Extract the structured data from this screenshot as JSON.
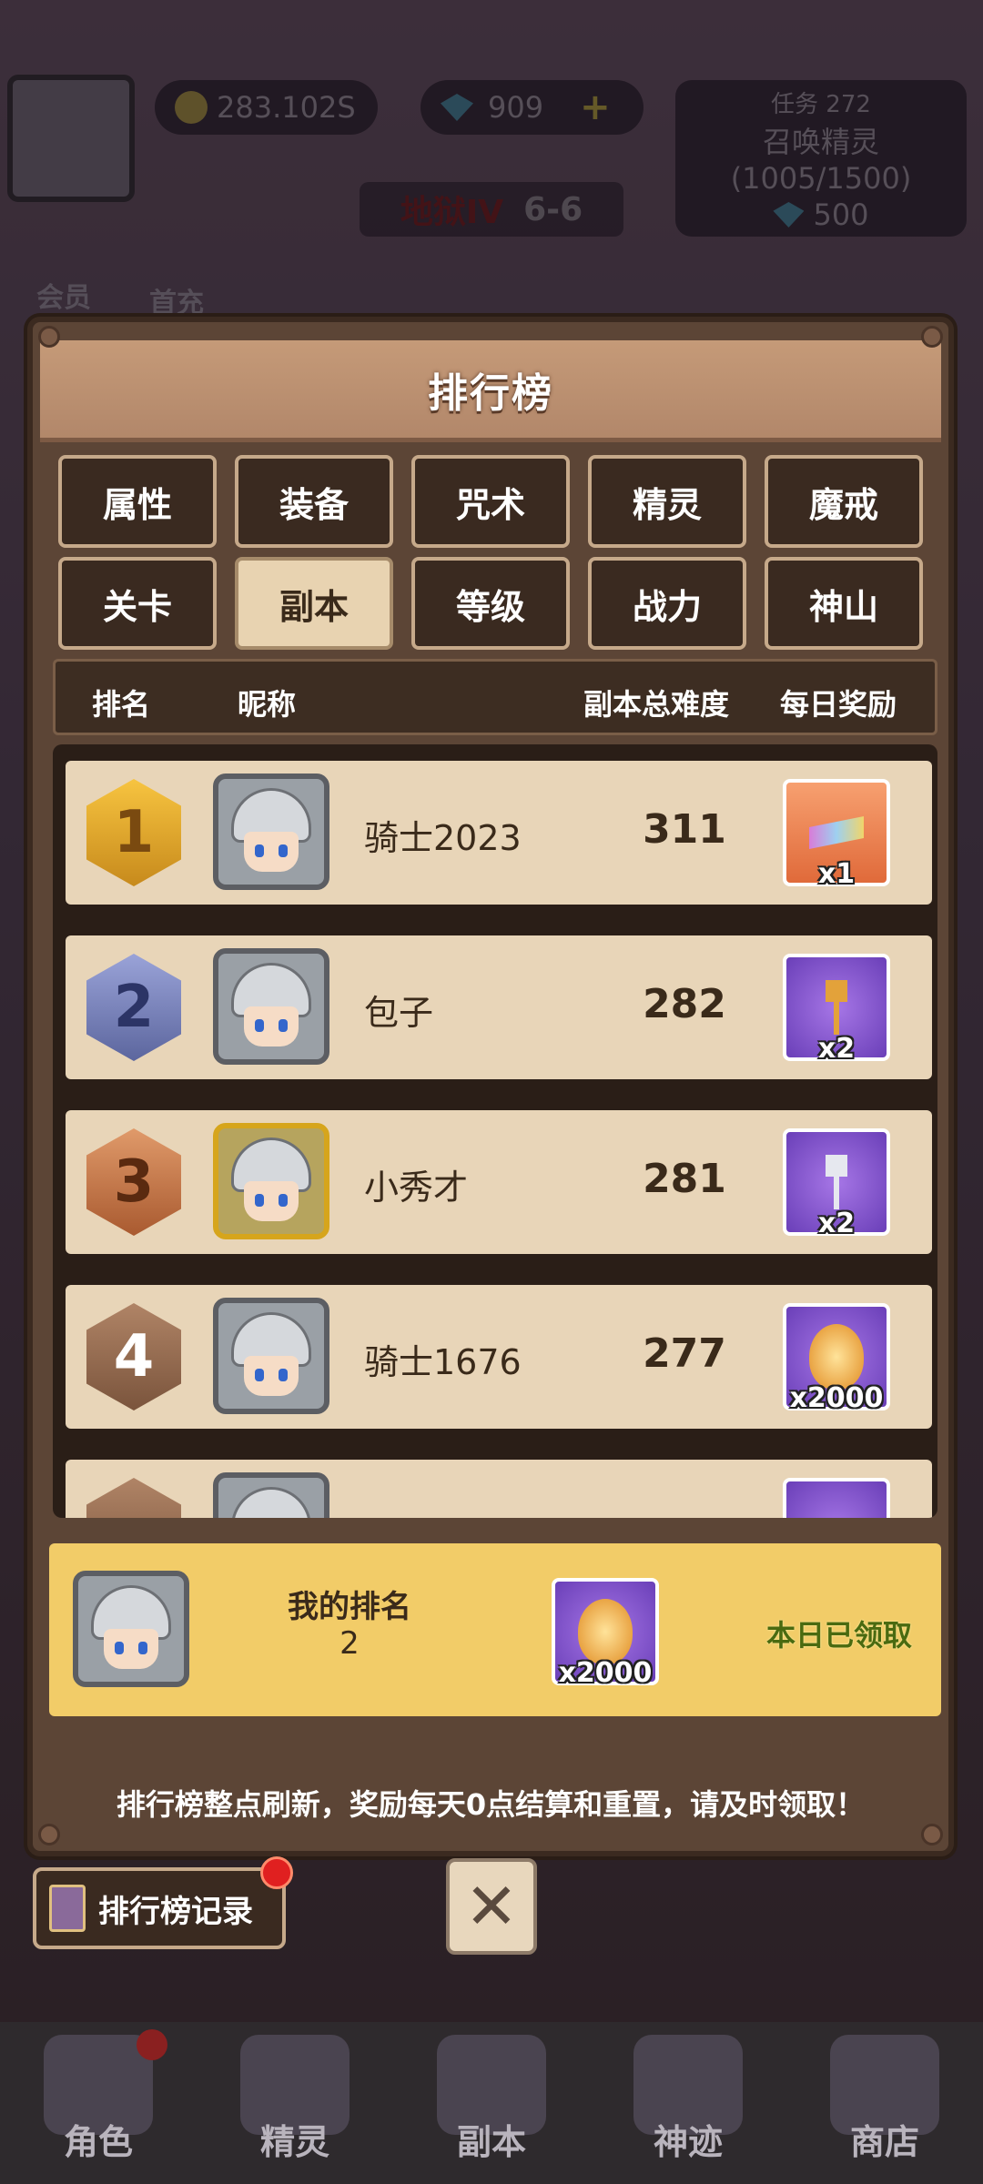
{
  "hud": {
    "gold": "283.102S",
    "gems": "909",
    "plus": "+",
    "task_title": "任务 272",
    "task_desc": "召唤精灵(1005/1500)",
    "task_reward": "500",
    "stage_name": "地狱IV",
    "stage_level": "6-6",
    "member_label": "会员",
    "first_charge_label": "首充"
  },
  "panel": {
    "title": "排行榜",
    "tabs": [
      {
        "label": "属性",
        "active": false
      },
      {
        "label": "装备",
        "active": false
      },
      {
        "label": "咒术",
        "active": false
      },
      {
        "label": "精灵",
        "active": false
      },
      {
        "label": "魔戒",
        "active": false
      },
      {
        "label": "关卡",
        "active": false
      },
      {
        "label": "副本",
        "active": true
      },
      {
        "label": "等级",
        "active": false
      },
      {
        "label": "战力",
        "active": false
      },
      {
        "label": "神山",
        "active": false
      }
    ],
    "columns": {
      "rank": "排名",
      "nickname": "昵称",
      "difficulty": "副本总难度",
      "reward": "每日奖励"
    },
    "rows": [
      {
        "rank": "1",
        "nickname": "骑士2023",
        "score": "311",
        "reward_item": "multi-key-icon",
        "reward_qty": "x1"
      },
      {
        "rank": "2",
        "nickname": "包子",
        "score": "282",
        "reward_item": "gold-key-icon",
        "reward_qty": "x2"
      },
      {
        "rank": "3",
        "nickname": "小秀才",
        "score": "281",
        "reward_item": "silver-key-icon",
        "reward_qty": "x2"
      },
      {
        "rank": "4",
        "nickname": "骑士1676",
        "score": "277",
        "reward_item": "egg-icon",
        "reward_qty": "x2000"
      }
    ],
    "my_rank": {
      "label": "我的排名",
      "value": "2",
      "reward_qty": "x2000",
      "status": "本日已领取"
    },
    "notice": "排行榜整点刷新，奖励每天0点结算和重置，请及时领取！"
  },
  "controls": {
    "history_label": "排行榜记录",
    "close_symbol": "✕"
  },
  "bottom_nav": [
    "角色",
    "精灵",
    "副本",
    "神迹",
    "商店"
  ],
  "colors": {
    "panel_bg": "#5c4536",
    "header_bg": "#c59a78",
    "row_bg": "#e8d5b8",
    "my_rank_bg": "#f2cc68",
    "active_tab": "#e8d3b1"
  }
}
